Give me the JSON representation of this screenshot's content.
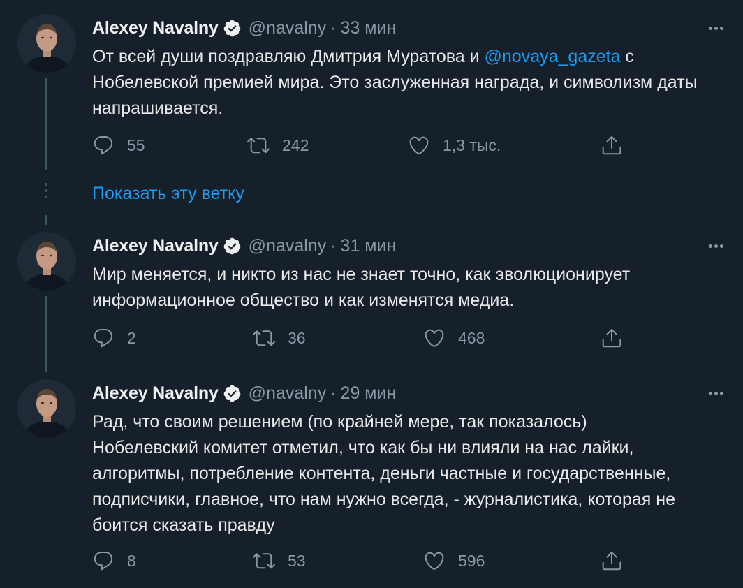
{
  "tweets": [
    {
      "name": "Alexey Navalny",
      "handle": "@navalny",
      "time": "33 мин",
      "text_before": "От всей души поздравляю Дмитрия Муратова и ",
      "mention": "@novaya_gazeta",
      "text_after": " с Нобелевской премией мира. Это заслуженная награда, и символизм даты напрашивается.",
      "replies": "55",
      "retweets": "242",
      "likes": "1,3 тыс."
    },
    {
      "name": "Alexey Navalny",
      "handle": "@navalny",
      "time": "31 мин",
      "text": "Мир меняется, и никто из нас не знает точно, как эволюционирует информационное общество и как изменятся медиа.",
      "replies": "2",
      "retweets": "36",
      "likes": "468"
    },
    {
      "name": "Alexey Navalny",
      "handle": "@navalny",
      "time": "29 мин",
      "text": "Рад, что своим решением (по крайней мере, так показалось) Нобелевский комитет отметил, что как бы ни влияли на нас лайки, алгоритмы, потребление контента, деньги частные и государственные, подписчики, главное, что нам нужно всегда, - журналистика, которая не боится сказать правду",
      "replies": "8",
      "retweets": "53",
      "likes": "596"
    }
  ],
  "thread": {
    "show_thread_label": "Показать эту ветку"
  },
  "colors": {
    "background": "#15202b",
    "accent": "#1d9bf0",
    "muted": "#8899a6"
  },
  "icons": [
    "verified-badge-icon",
    "more-icon",
    "reply-icon",
    "retweet-icon",
    "like-icon",
    "share-icon"
  ]
}
